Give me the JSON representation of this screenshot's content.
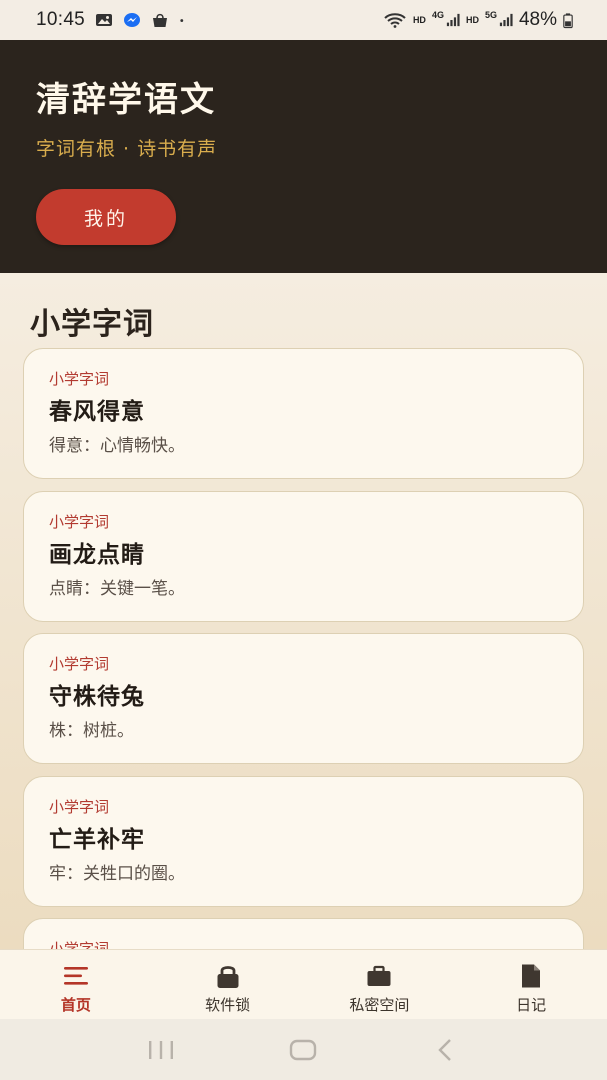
{
  "status_bar": {
    "time": "10:45",
    "hd1": "HD",
    "net1": "4G",
    "hd2": "HD",
    "net2": "5G",
    "battery": "48%"
  },
  "header": {
    "title": "清辞学语文",
    "subtitle": "字词有根 · 诗书有声",
    "mine_button": "我的"
  },
  "section": {
    "title": "小学字词"
  },
  "cards": [
    {
      "tag": "小学字词",
      "word": "春风得意",
      "note": "得意：心情畅快。"
    },
    {
      "tag": "小学字词",
      "word": "画龙点睛",
      "note": "点睛：关键一笔。"
    },
    {
      "tag": "小学字词",
      "word": "守株待兔",
      "note": "株：树桩。"
    },
    {
      "tag": "小学字词",
      "word": "亡羊补牢",
      "note": "牢：关牲口的圈。"
    },
    {
      "tag": "小学字词",
      "word": "",
      "note": ""
    }
  ],
  "bottom_nav": [
    {
      "label": "首页",
      "icon": "menu-icon",
      "active": true
    },
    {
      "label": "软件锁",
      "icon": "lock-icon",
      "active": false
    },
    {
      "label": "私密空间",
      "icon": "briefcase-icon",
      "active": false
    },
    {
      "label": "日记",
      "icon": "document-icon",
      "active": false
    }
  ],
  "colors": {
    "header_bg": "#2b241d",
    "accent_red": "#c23b2e",
    "subtitle_gold": "#d9ad4d",
    "card_bg": "#fdf8ee"
  }
}
